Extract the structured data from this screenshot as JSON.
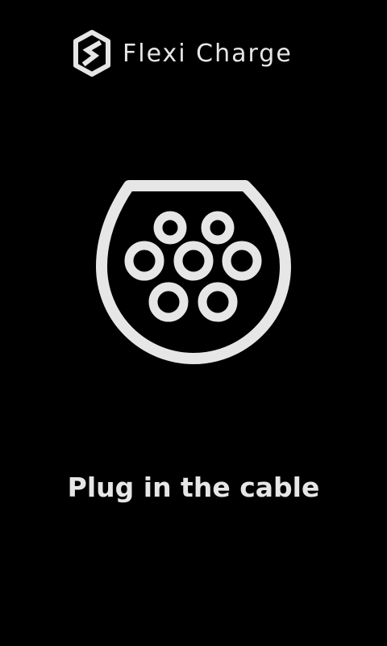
{
  "header": {
    "brand_name": "Flexi Charge",
    "logo_icon": "flexi-charge-logo-icon"
  },
  "main": {
    "illustration_icon": "ev-charger-plug-icon",
    "instruction": "Plug in the cable"
  },
  "colors": {
    "background": "#000000",
    "foreground": "#e6e6e6"
  }
}
